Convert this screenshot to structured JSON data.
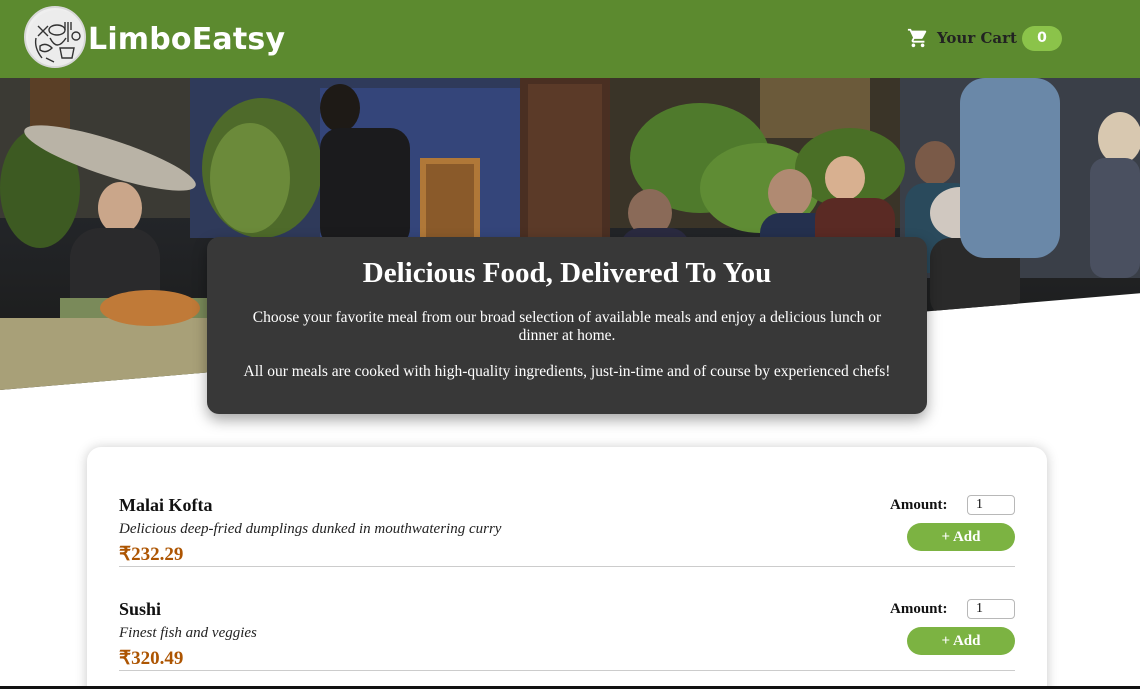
{
  "header": {
    "brand": "LimboEatsy",
    "cart_label": "Your Cart",
    "cart_count": "0",
    "cart_icon": "cart-icon",
    "logo_icon": "restaurant-logo"
  },
  "summary": {
    "title": "Delicious Food, Delivered To You",
    "paragraph1": "Choose your favorite meal from our broad selection of available meals and enjoy a delicious lunch or dinner at home.",
    "paragraph2": "All our meals are cooked with high-quality ingredients, just-in-time and of course by experienced chefs!"
  },
  "meals": [
    {
      "name": "Malai Kofta",
      "description": "Delicious deep-fried dumplings dunked in mouthwatering curry",
      "price": "₹232.29",
      "amount_label": "Amount:",
      "amount_value": "1",
      "add_label": "+ Add"
    },
    {
      "name": "Sushi",
      "description": "Finest fish and veggies",
      "price": "₹320.49",
      "amount_label": "Amount:",
      "amount_value": "1",
      "add_label": "+ Add"
    }
  ],
  "colors": {
    "header": "#5c8a2f",
    "badge": "#8bc34a",
    "button": "#7cb342",
    "price": "#ad5502",
    "summary_bg": "#383838"
  }
}
